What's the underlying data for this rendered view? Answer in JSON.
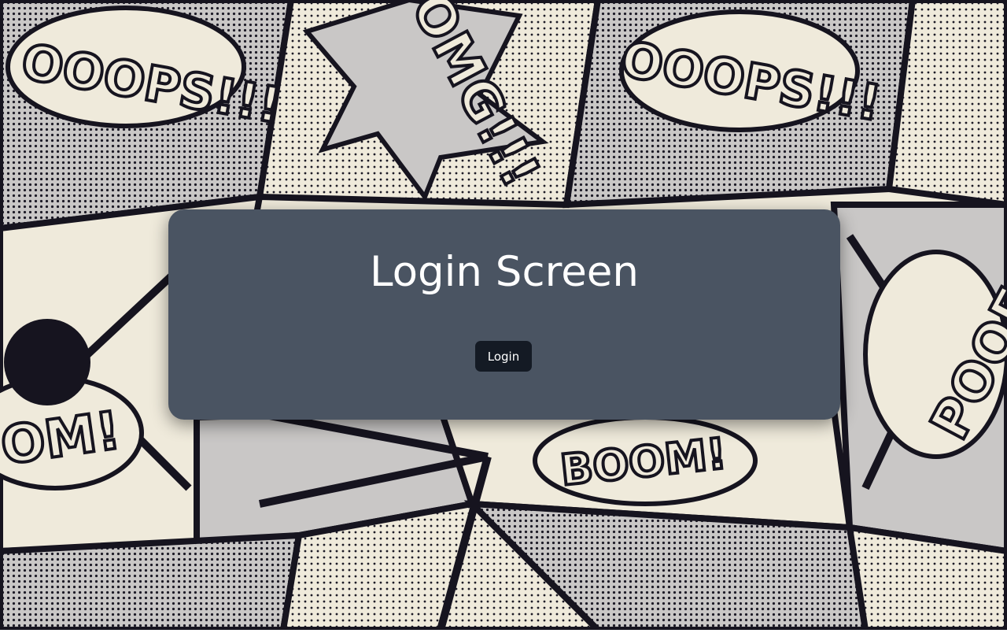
{
  "background": {
    "words": [
      "OOOPS!!!",
      "OMG!!!",
      "OOOPS!!!",
      "BOOM!",
      "OM!",
      "POOF"
    ]
  },
  "login": {
    "title": "Login Screen",
    "button_label": "Login"
  },
  "colors": {
    "card": "#4a5462",
    "button": "#141a24",
    "text": "#ffffff",
    "paper": "#efeadb",
    "ink": "#16141f"
  }
}
